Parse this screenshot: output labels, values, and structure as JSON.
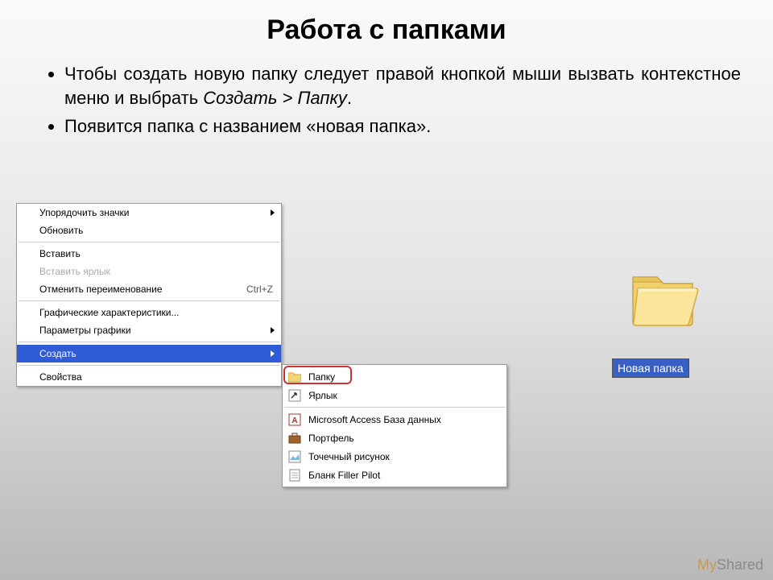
{
  "title": "Работа с папками",
  "bullet1_a": "Чтобы создать новую папку следует правой кнопкой мыши вызвать контекстное меню и выбрать ",
  "bullet1_b": "Создать > Папку",
  "bullet1_c": ".",
  "bullet2": "Появится папка с названием «новая папка».",
  "menu": {
    "arrange": "Упорядочить значки",
    "refresh": "Обновить",
    "paste": "Вставить",
    "paste_shortcut": "Вставить ярлык",
    "undo_rename": "Отменить переименование",
    "undo_key": "Ctrl+Z",
    "gfx_props": "Графические характеристики...",
    "gfx_params": "Параметры графики",
    "create": "Создать",
    "properties": "Свойства"
  },
  "submenu": {
    "folder": "Папку",
    "shortcut": "Ярлык",
    "access": "Microsoft Access База данных",
    "briefcase": "Портфель",
    "bitmap": "Точечный рисунок",
    "filler": "Бланк Filler Pilot"
  },
  "new_folder_label": "Новая папка",
  "watermark_a": "My",
  "watermark_b": "Shared"
}
